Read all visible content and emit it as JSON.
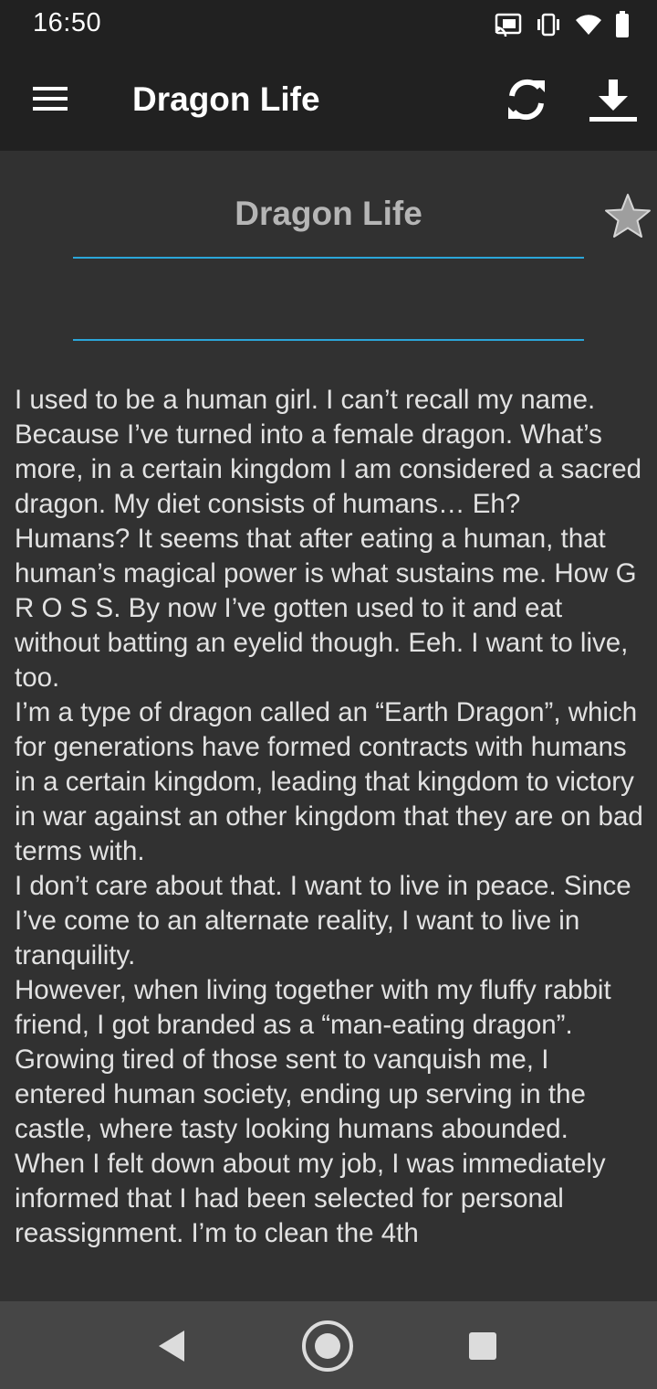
{
  "status_bar": {
    "time": "16:50",
    "icons": [
      "cast-icon",
      "vibrate-icon",
      "wifi-icon",
      "battery-icon"
    ]
  },
  "app_bar": {
    "title": "Dragon Life",
    "menu_icon": "hamburger-menu-icon",
    "refresh_icon": "refresh-icon",
    "download_icon": "download-icon"
  },
  "story": {
    "title": "Dragon Life",
    "favorite_icon": "star-icon",
    "paragraphs": [
      "I used to be a human girl. I can’t recall my name. Because I’ve turned into a female dragon. What’s more, in a certain kingdom I am considered a sacred dragon. My diet consists of humans… Eh?",
      "Humans? It seems that after eating a human, that human’s magical power is what sustains me. How G R O S S. By now I’ve gotten used to it and eat without batting an eyelid though. Eeh. I want to live, too.",
      "I’m a type of dragon called an “Earth Dragon”, which for generations have formed contracts with humans in a certain kingdom, leading that kingdom to victory in war against an other kingdom that they are on bad terms with.",
      "I don’t care about that. I want to live in peace. Since I’ve come to an alternate reality, I want to live in tranquility.",
      "However, when living together with my fluffy rabbit friend, I got branded as a “man-eating dragon”. Growing tired of those sent to vanquish me, I entered human society, ending up serving in the castle, where tasty looking humans abounded.",
      "When I felt down about my job, I was immediately informed that I had been selected for personal reassignment. I’m to clean the 4th"
    ]
  },
  "nav_bar": {
    "back_icon": "back-triangle-icon",
    "home_icon": "home-circle-icon",
    "recents_icon": "recents-square-icon"
  },
  "colors": {
    "bar_background": "#212121",
    "content_background": "#313131",
    "accent_underline": "#2ba6d9",
    "title_text": "#b5b5b5",
    "body_text": "#e2e2e2",
    "nav_background": "#464646"
  }
}
